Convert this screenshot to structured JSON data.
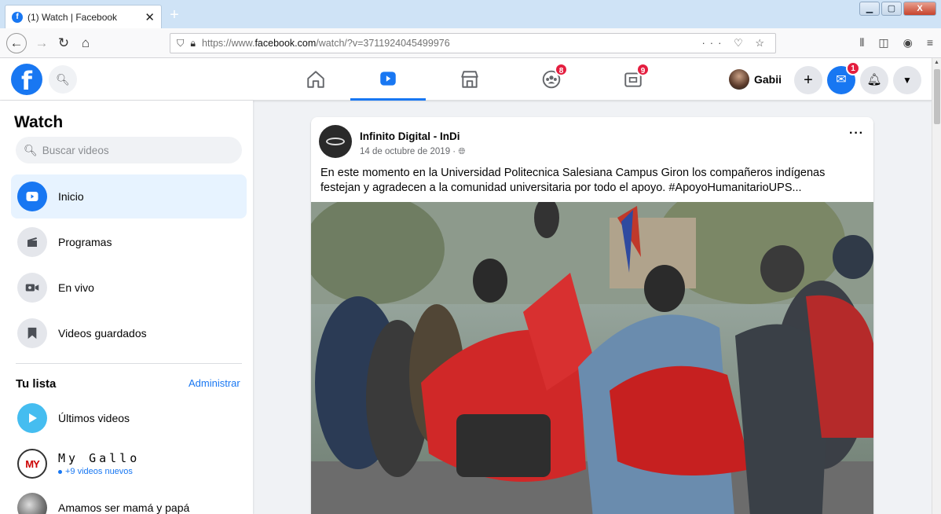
{
  "browser": {
    "tab_title": "(1) Watch | Facebook",
    "tab_close": "✕",
    "new_tab": "+",
    "url_prefix": "https://www.",
    "url_host": "facebook.com",
    "url_path": "/watch/?v=3711924045499976",
    "url_icons": "··· ♡ ☆",
    "win_minimize": "▁",
    "win_maximize": "▢",
    "win_close": "X"
  },
  "header": {
    "logo": "f",
    "user_name": "Gabii",
    "groups_badge": "8",
    "gaming_badge": "9",
    "messenger_badge": "1"
  },
  "sidebar": {
    "title": "Watch",
    "search_placeholder": "Buscar videos",
    "items": [
      {
        "label": "Inicio"
      },
      {
        "label": "Programas"
      },
      {
        "label": "En vivo"
      },
      {
        "label": "Videos guardados"
      }
    ],
    "list_title": "Tu lista",
    "admin_link": "Administrar",
    "list": [
      {
        "label": "Últimos videos"
      },
      {
        "label": "My Gallo",
        "sub": "+9 videos nuevos",
        "logo": "MY"
      },
      {
        "label": "Amamos ser mamá y papá"
      }
    ]
  },
  "post": {
    "page_name": "Infinito Digital - InDi",
    "date": "14 de octubre de 2019 · ",
    "more": "···",
    "text": "En este momento en la Universidad Politecnica Salesiana Campus Giron los compañeros indígenas festejan y agradecen a la comunidad universitaria por todo el apoyo. #ApoyoHumanitarioUPS..."
  },
  "colors": {
    "accent": "#1877f2",
    "badge": "#e41e3f",
    "background": "#f0f2f5"
  }
}
